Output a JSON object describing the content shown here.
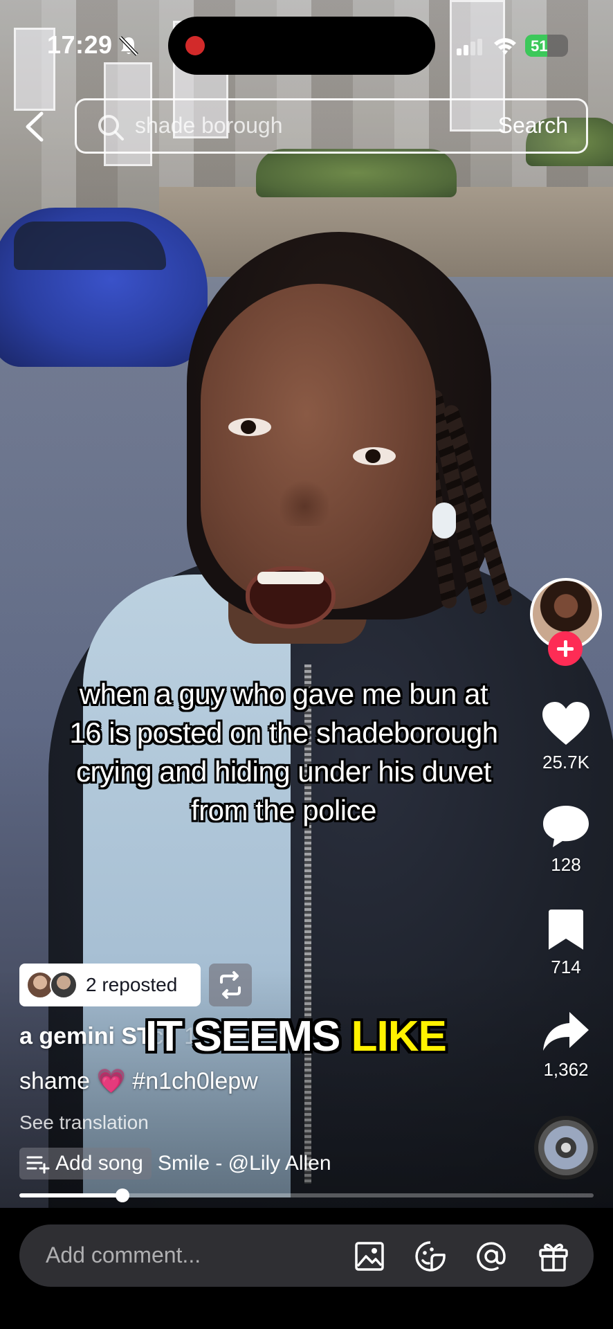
{
  "status_bar": {
    "time": "17:29",
    "battery_level": 51,
    "battery_label": "51",
    "battery_color": "#3cc85a",
    "icons": [
      "bell-muted-icon",
      "signal-icon",
      "wifi-icon",
      "battery-icon"
    ]
  },
  "search": {
    "query": "shade borough",
    "button_label": "Search"
  },
  "video": {
    "caption": "when a guy who gave me bun at 16 is posted on the shadeborough crying and hiding under his duvet from the police",
    "overlay_subtitle_main": "IT SEEMS ",
    "overlay_subtitle_highlight": "LIKE",
    "overlay_highlight_color": "#fff200",
    "progress": 0.18
  },
  "actions": {
    "likes": "25.7K",
    "comments": "128",
    "bookmarks": "714",
    "shares": "1,362",
    "follow_color": "#fe2c55"
  },
  "post": {
    "repost_label": "2 reposted",
    "username_visible": "a gemini ST",
    "username_faded": "c · 1",
    "description_text": "shame ",
    "description_emoji": "💗",
    "description_tag": " #n1ch0lepw",
    "see_translation": "See translation",
    "add_song_label": "Add song",
    "song": "Smile - @Lily Allen"
  },
  "comment_bar": {
    "placeholder": "Add comment...",
    "icons": [
      "image-icon",
      "emoji-sticker-icon",
      "mention-icon",
      "gift-icon"
    ]
  }
}
